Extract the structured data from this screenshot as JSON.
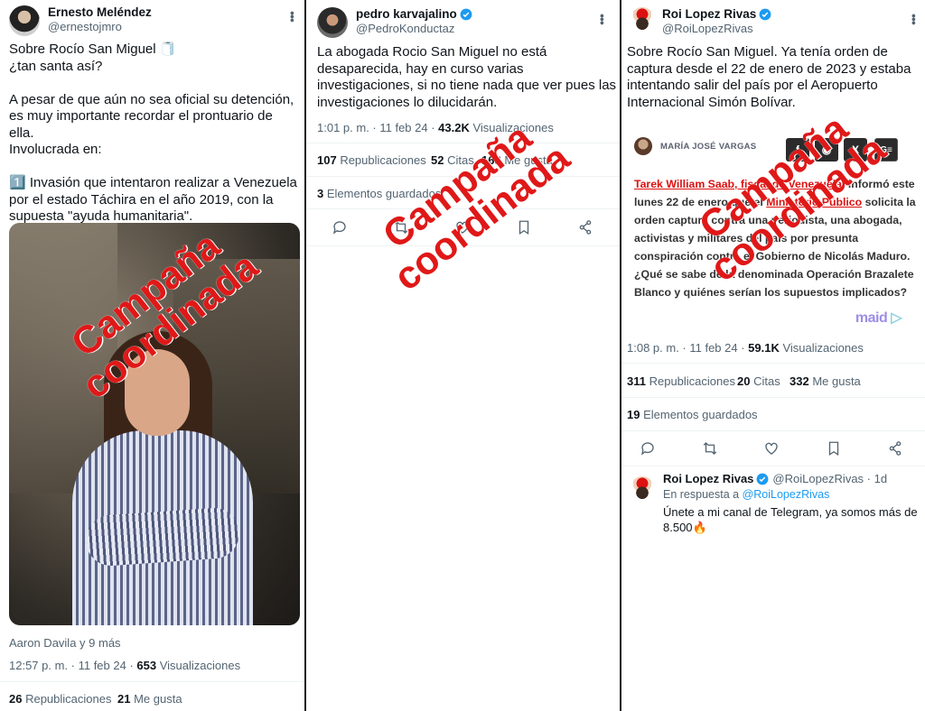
{
  "tweet1": {
    "name": "Ernesto Meléndez",
    "handle": "@ernestojmro",
    "lines": [
      "Sobre Rocío San Miguel 🧻",
      "¿tan santa así?",
      "",
      "A pesar de que aún no sea oficial su detención,",
      "es muy importante recordar el prontuario de ella.",
      "Involucrada en:",
      "",
      "1️⃣ Invasión que intentaron realizar a Venezuela",
      "por el estado Táchira en el año 2019, con la",
      "supuesta \"ayuda humanitaria\"."
    ],
    "photo_credit": "Aaron Davila y 9 más",
    "timestamp": "12:57 p. m. · 11 feb 24 · ",
    "views_count": "653",
    "views_label": " Visualizaciones",
    "reposts_count": "26",
    "reposts_label": " Republicaciones",
    "likes_count": "21",
    "likes_label": " Me gusta"
  },
  "tweet2": {
    "name": "pedro karvajalino",
    "handle": "@PedroKonductaz",
    "lines": [
      "La abogada Rocio San Miguel no está",
      "desaparecida, hay en curso varias",
      "investigaciones, si no tiene nada que ver pues las",
      "investigaciones lo dilucidarán."
    ],
    "timestamp": "1:01 p. m. · 11 feb 24 · ",
    "views_count": "43.2K",
    "views_label": " Visualizaciones",
    "reposts_count": "107",
    "reposts_label": " Republicaciones",
    "quotes_count": "52",
    "quotes_label": " Citas",
    "likes_count": "168",
    "likes_label": " Me gusta",
    "bookmarks_count": "3",
    "bookmarks_label": " Elementos guardados"
  },
  "tweet3": {
    "name": "Roi Lopez Rivas",
    "handle": "@RoiLopezRivas",
    "lines": [
      "Sobre Rocío San Miguel. Ya tenía orden de",
      "captura desde el 22 de enero de 2023 y estaba",
      "intentando salir del país por el Aeropuerto",
      "Internacional Simón Bolívar."
    ],
    "article": {
      "author": "MARÍA JOSÉ VARGAS",
      "share_buttons": [
        "f",
        "◉",
        "X",
        "G≡"
      ],
      "link1": "Tarek William Saab, fiscal de Venezuela",
      "text1": ", informó este lunes 22 de enero que el ",
      "link2": "Ministerio Público",
      "text2": " solicita la orden captura contra una periodista, una abogada, activistas y militares del país por presunta conspiración contra el Gobierno de Nicolás Maduro. ¿Qué se sabe de la denominada Operación Brazalete Blanco y quiénes serían los supuestos implicados?",
      "brand": "maid",
      "brand_mark": "▷"
    },
    "timestamp": "1:08 p. m. · 11 feb 24 · ",
    "views_count": "59.1K",
    "views_label": " Visualizaciones",
    "reposts_count": "311",
    "reposts_label": " Republicaciones",
    "quotes_count": "20",
    "quotes_label": " Citas",
    "likes_count": "332",
    "likes_label": " Me gusta",
    "bookmarks_count": "19",
    "bookmarks_label": " Elementos guardados"
  },
  "reply": {
    "name": "Roi Lopez Rivas",
    "handle_time": "@RoiLopezRivas · 1d",
    "in_reply_prefix": "En respuesta a ",
    "in_reply_handle": "@RoiLopezRivas",
    "line1": "Únete a mi canal de Telegram, ya somos más de",
    "line2": "8.500🔥"
  },
  "watermark": {
    "line1": "Campaña",
    "line2": "coordinada"
  },
  "colors": {
    "watermark": "#e01818",
    "link": "#1d9bf0",
    "verified": "#1d9bf0",
    "muted": "#536471"
  }
}
